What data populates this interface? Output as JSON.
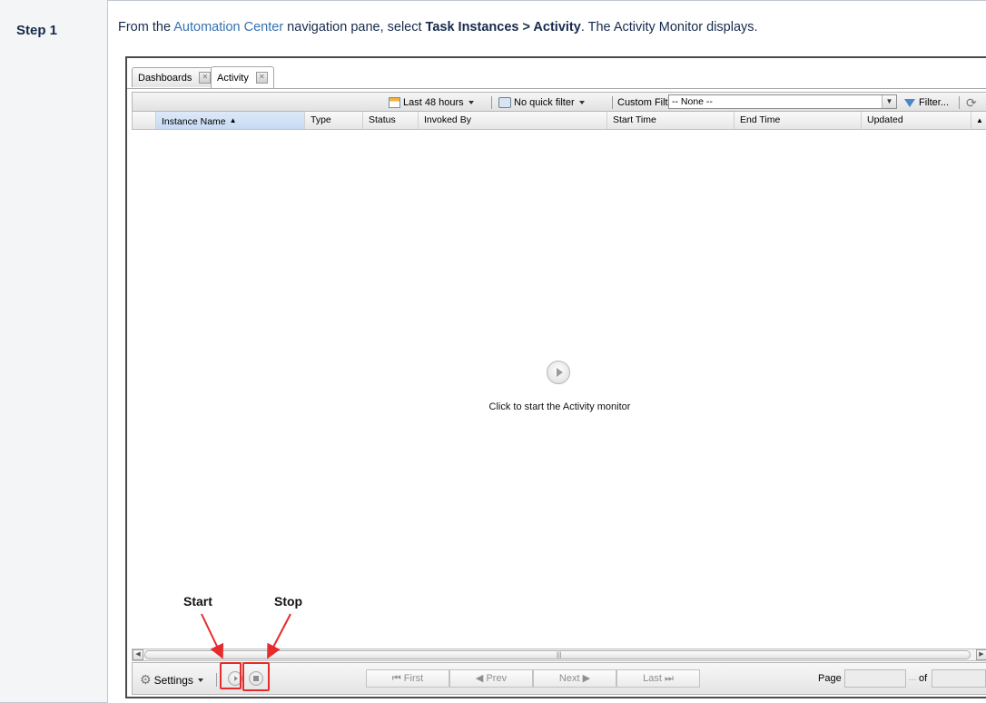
{
  "doc": {
    "step_label": "Step 1",
    "text_before_link": "From the ",
    "link_text": "Automation Center",
    "text_after_link": " navigation pane, select ",
    "bold_text": "Task Instances > Activity",
    "text_end": ". The Activity Monitor displays."
  },
  "app": {
    "tabs": [
      {
        "label": "Dashboards",
        "close_icon": "close-icon"
      },
      {
        "label": "Activity",
        "close_icon": "close-icon"
      }
    ],
    "toolbar": {
      "time_range": "Last 48 hours",
      "quick_filter": "No quick filter",
      "custom_filter_label": "Custom Filter",
      "custom_filter_value": "-- None --",
      "filter_button": "Filter..."
    },
    "columns": [
      "Instance Name",
      "Type",
      "Status",
      "Invoked By",
      "Start Time",
      "End Time",
      "Updated"
    ],
    "sorted_column": "Instance Name",
    "empty_message": "Click to start the Activity monitor",
    "bottom": {
      "settings_label": "Settings",
      "first": "First",
      "prev": "Prev",
      "next": "Next",
      "last": "Last",
      "page_label": "Page",
      "of_label": "of",
      "ellipsis": "..."
    }
  },
  "annotations": {
    "start_label": "Start",
    "stop_label": "Stop",
    "color": "#e52b2b"
  }
}
